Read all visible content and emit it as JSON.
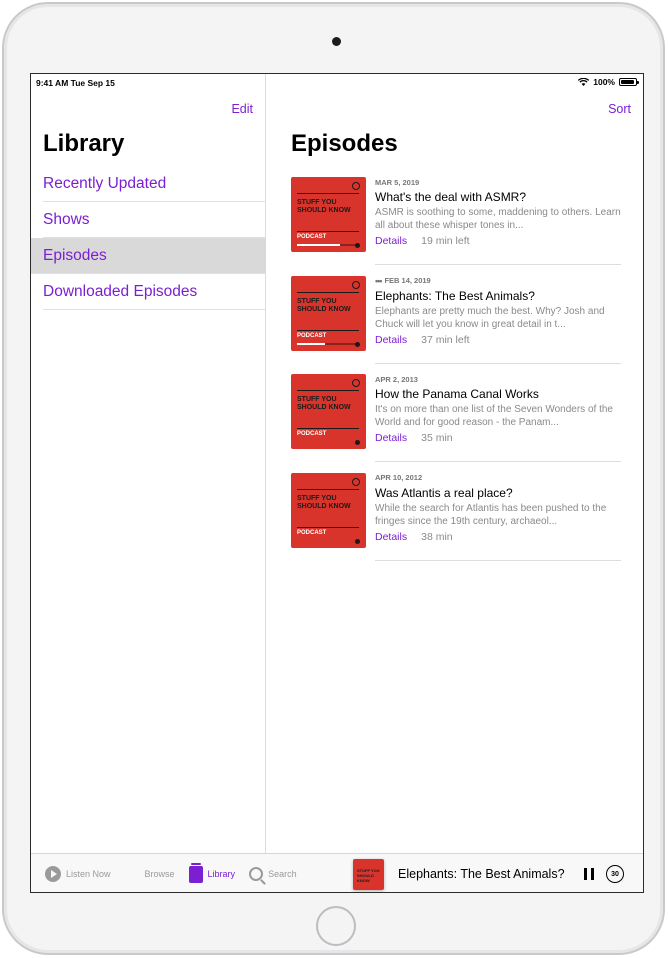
{
  "status_bar": {
    "time": "9:41 AM  Tue Sep 15",
    "battery": "100%"
  },
  "sidebar": {
    "edit_label": "Edit",
    "title": "Library",
    "items": [
      {
        "label": "Recently Updated"
      },
      {
        "label": "Shows"
      },
      {
        "label": "Episodes",
        "selected": true
      },
      {
        "label": "Downloaded Episodes"
      }
    ]
  },
  "main": {
    "sort_label": "Sort",
    "title": "Episodes",
    "artwork": {
      "text": "STUFF YOU SHOULD KNOW",
      "badge": "PODCAST"
    },
    "episodes": [
      {
        "date": "MAR 5, 2019",
        "title": "What's the deal with ASMR?",
        "description": "ASMR is soothing to some, maddening to others. Learn all about these whisper tones in...",
        "details": "Details",
        "duration": "19 min left",
        "progress": 0.7
      },
      {
        "date": "FEB 14, 2019",
        "title": "Elephants: The Best Animals?",
        "description": "Elephants are pretty much the best. Why? Josh and Chuck will let you know in great detail in t...",
        "details": "Details",
        "duration": "37 min left",
        "progress": 0.45,
        "playing": true
      },
      {
        "date": "APR 2, 2013",
        "title": "How the Panama Canal Works",
        "description": "It's on more than one list of the Seven Wonders of the World and for good reason - the Panam...",
        "details": "Details",
        "duration": "35 min"
      },
      {
        "date": "APR 10, 2012",
        "title": "Was Atlantis a real place?",
        "description": "While the search for Atlantis has been pushed to the fringes since the 19th century, archaeol...",
        "details": "Details",
        "duration": "38 min"
      }
    ]
  },
  "tab_bar": {
    "tabs": [
      {
        "label": "Listen Now",
        "icon": "play-circle-icon"
      },
      {
        "label": "Browse",
        "icon": "grid-icon"
      },
      {
        "label": "Library",
        "icon": "library-icon",
        "active": true
      },
      {
        "label": "Search",
        "icon": "search-icon"
      }
    ]
  },
  "mini_player": {
    "title": "Elephants: The Best Animals?",
    "skip_label": "30"
  },
  "colors": {
    "accent": "#7a1fd1",
    "artwork": "#d9342b"
  }
}
